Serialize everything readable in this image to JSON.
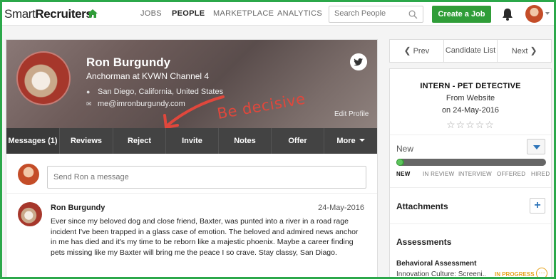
{
  "brand": {
    "logo_part1": "Smart",
    "logo_part2": "Recruiters"
  },
  "nav": {
    "links": [
      "JOBS",
      "PEOPLE",
      "MARKETPLACE",
      "ANALYTICS"
    ],
    "active": "PEOPLE"
  },
  "search": {
    "placeholder": "Search People"
  },
  "create_job": "Create a Job",
  "candidate": {
    "name": "Ron Burgundy",
    "title": "Anchorman at KVWN Channel 4",
    "location": "San Diego, California, United States",
    "email": "me@imronburgundy.com",
    "edit_label": "Edit Profile"
  },
  "annotation": "Be decisive",
  "tabs": [
    "Messages (1)",
    "Reviews",
    "Reject",
    "Invite",
    "Notes",
    "Offer",
    "More"
  ],
  "message_input": {
    "placeholder": "Send Ron a message"
  },
  "post": {
    "author": "Ron Burgundy",
    "date": "24-May-2016",
    "body": "Ever since my beloved dog and close friend, Baxter, was punted into a river in a road rage incident I've been trapped in a glass case of emotion. The beloved and admired news anchor in me has died and it's my time to be reborn like a majestic phoenix. Maybe a career finding pets missing like my Baxter will bring me the peace I so crave. Stay classy, San Diago."
  },
  "pager": {
    "prev": "Prev",
    "list": "Candidate List",
    "next": "Next"
  },
  "job": {
    "title": "INTERN - PET DETECTIVE",
    "source": "From Website",
    "date": "on 24-May-2016",
    "rating": 0,
    "rating_max": 5
  },
  "stage": {
    "current": "New",
    "steps": [
      "NEW",
      "IN REVIEW",
      "INTERVIEW",
      "OFFERED",
      "HIRED"
    ],
    "current_index": 0,
    "progress": 0.05
  },
  "sections": {
    "attachments": "Attachments",
    "assessments": "Assessments"
  },
  "assessment": {
    "name": "Behavioral Assessment",
    "subtitle": "Innovation Culture: Screeni...",
    "status": "IN PROGRESS",
    "more": "…"
  },
  "colors": {
    "green": "#2f9d38",
    "blue": "#2d74b9",
    "orange": "#e6a21a",
    "annotation": "#e0473c"
  }
}
